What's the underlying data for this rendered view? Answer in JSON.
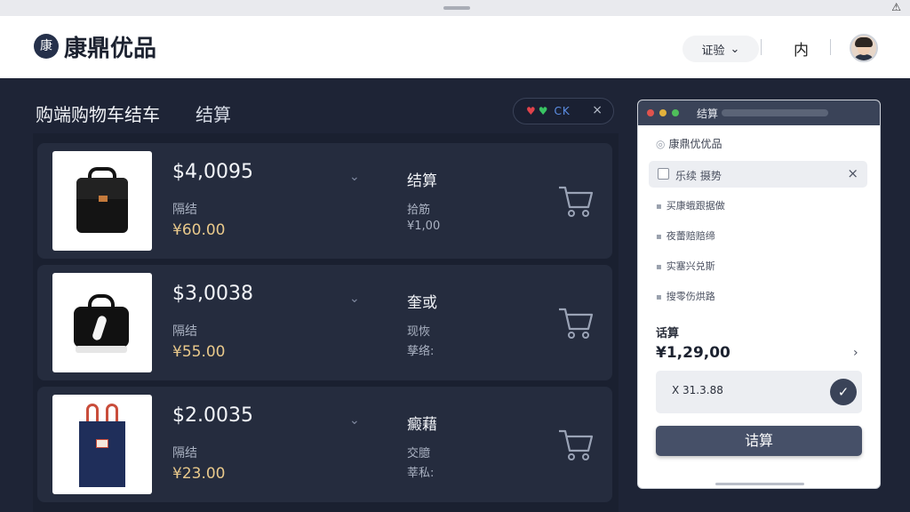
{
  "os": {
    "corner_icon": "wifi-off-icon"
  },
  "header": {
    "logo_char": "康",
    "brand": "康鼎优品",
    "lang_label": "证验",
    "lang_chevron": "⌄",
    "glyph": "内"
  },
  "main": {
    "title": "购端购物车结车",
    "subtitle": "结算",
    "status_pill": {
      "text": "CK",
      "close": "×"
    }
  },
  "cart": {
    "items": [
      {
        "price": "$4,0095",
        "price_label": "隔结",
        "price_sub": "¥60.00",
        "col2_title": "结算",
        "col2_label": "拾筋",
        "col2_value": "¥1,00"
      },
      {
        "price": "$3,0038",
        "price_label": "隔结",
        "price_sub": "¥55.00",
        "col2_title": "奎或",
        "col2_label": "现恢",
        "col2_value": "孳络:"
      },
      {
        "price": "$2.0035",
        "price_label": "隔结",
        "price_sub": "¥23.00",
        "col2_title": "癜藉",
        "col2_label": "交臆",
        "col2_value": "莘私:"
      }
    ]
  },
  "panel": {
    "title": "结算",
    "brand": "康鼎优优品",
    "field": {
      "text": "乐续  摄势",
      "close": "×"
    },
    "options": [
      "买康蛾跟据做",
      "夜蕾赔赔缔",
      "实塞兴兑斯",
      "搜零伤烘路"
    ],
    "sum_label": "话算",
    "sum_value": "¥1,29,00",
    "code": "X 31.3.88",
    "submit": "诘算"
  },
  "colors": {
    "background": "#1e2436",
    "card": "#252c3e",
    "accent": "#465068",
    "price_sub": "#e9c98b"
  }
}
